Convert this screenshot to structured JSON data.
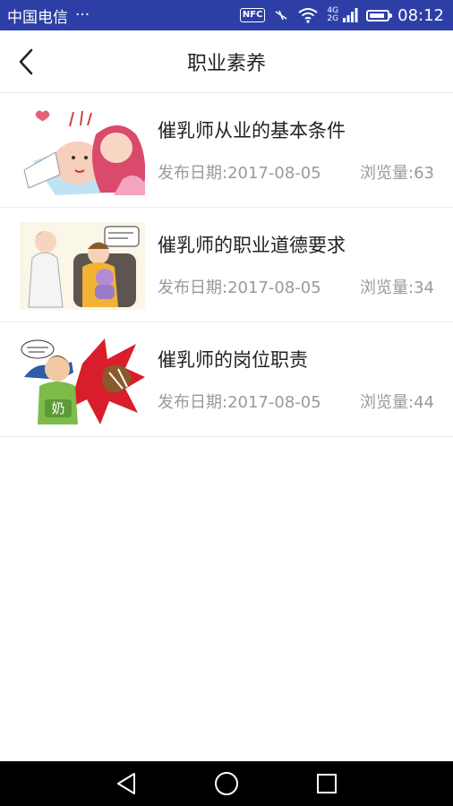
{
  "status_bar": {
    "carrier": "中国电信",
    "more": "···",
    "nfc": "NFC",
    "net_top": "4G",
    "net_bottom": "2G",
    "battery_level": 0.9,
    "time": "08:12"
  },
  "header": {
    "title": "职业素养",
    "back_icon": "chevron-left-icon"
  },
  "articles": [
    {
      "title": "催乳师从业的基本条件",
      "date": "发布日期:2017-08-05",
      "views": "浏览量:63"
    },
    {
      "title": "催乳师的职业道德要求",
      "date": "发布日期:2017-08-05",
      "views": "浏览量:34"
    },
    {
      "title": "催乳师的岗位职责",
      "date": "发布日期:2017-08-05",
      "views": "浏览量:44",
      "thumb_text": "奶"
    }
  ],
  "colors": {
    "status_bar": "#2d3fa6",
    "meta_text": "#9a9a9a",
    "divider": "#ececec"
  },
  "nav_bar": {
    "back_icon": "triangle-back-icon",
    "home_icon": "circle-home-icon",
    "recents_icon": "square-recents-icon"
  }
}
